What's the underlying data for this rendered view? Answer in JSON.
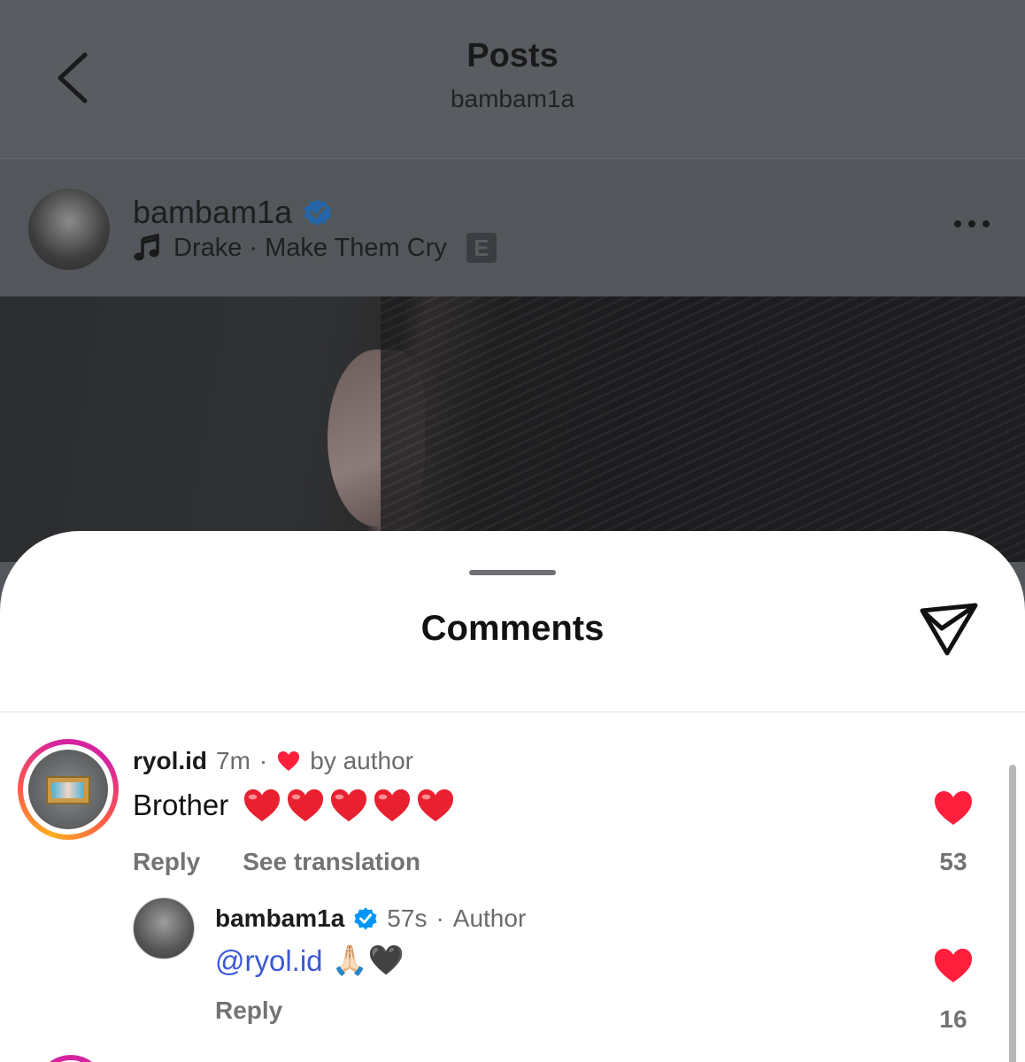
{
  "header": {
    "title": "Posts",
    "subtitle": "bambam1a"
  },
  "post": {
    "username": "bambam1a",
    "music": "Drake · Make Them Cry",
    "explicit_badge": "E"
  },
  "sheet": {
    "title": "Comments"
  },
  "comments": [
    {
      "username": "ryol.id",
      "time": "7m",
      "liked_by_author": "by author",
      "text": "Brother",
      "emoji_hearts": 5,
      "reply_label": "Reply",
      "translate_label": "See translation",
      "likes": "53",
      "replies": [
        {
          "username": "bambam1a",
          "time": "57s",
          "role": "Author",
          "mention": "@ryol.id",
          "emoji": "🙏🏻🖤",
          "reply_label": "Reply",
          "likes": "16"
        }
      ]
    }
  ],
  "colors": {
    "heart": "#ff3040",
    "verified": "#0095f6",
    "mention": "#3a58d6"
  }
}
